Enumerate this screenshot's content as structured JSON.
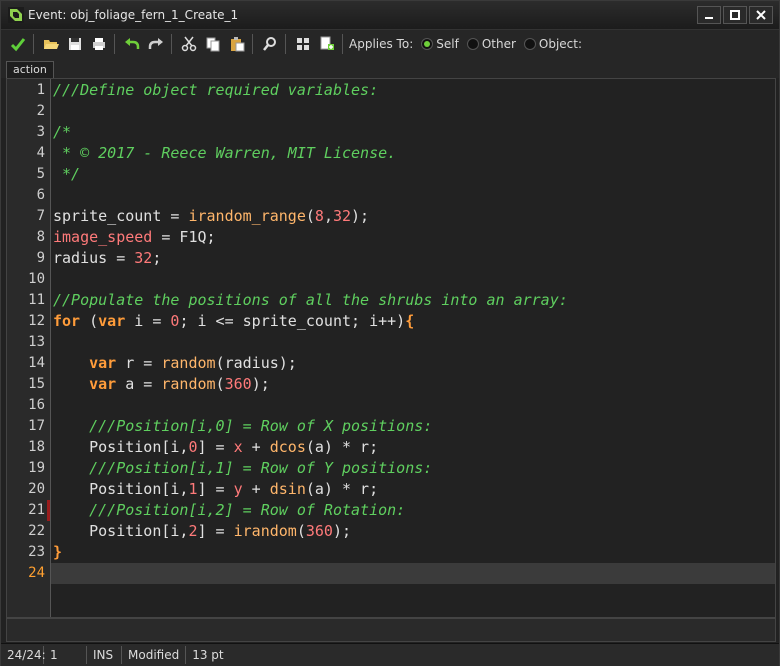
{
  "window": {
    "title": "Event: obj_foliage_fern_1_Create_1"
  },
  "toolbar": {
    "applies_to_label": "Applies To:",
    "options": [
      {
        "label": "Self",
        "selected": true
      },
      {
        "label": "Other",
        "selected": false
      },
      {
        "label": "Object:",
        "selected": false
      }
    ]
  },
  "tabs": [
    {
      "label": "action"
    }
  ],
  "editor": {
    "current_line": 24,
    "marked_line": 21,
    "lines": [
      [
        {
          "t": "com",
          "v": "///Define object required variables:"
        }
      ],
      [],
      [
        {
          "t": "com",
          "v": "/*"
        }
      ],
      [
        {
          "t": "com",
          "v": " * © 2017 - Reece Warren, MIT License."
        }
      ],
      [
        {
          "t": "com",
          "v": " */"
        }
      ],
      [],
      [
        {
          "t": "txt",
          "v": "sprite_count = "
        },
        {
          "t": "fn",
          "v": "irandom_range"
        },
        {
          "t": "txt",
          "v": "("
        },
        {
          "t": "num",
          "v": "8"
        },
        {
          "t": "txt",
          "v": ","
        },
        {
          "t": "num",
          "v": "32"
        },
        {
          "t": "txt",
          "v": ");"
        }
      ],
      [
        {
          "t": "bi",
          "v": "image_speed"
        },
        {
          "t": "txt",
          "v": " = F1Q;"
        }
      ],
      [
        {
          "t": "txt",
          "v": "radius = "
        },
        {
          "t": "num",
          "v": "32"
        },
        {
          "t": "txt",
          "v": ";"
        }
      ],
      [],
      [
        {
          "t": "com",
          "v": "//Populate the positions of all the shrubs into an array:"
        }
      ],
      [
        {
          "t": "kw",
          "v": "for"
        },
        {
          "t": "txt",
          "v": " ("
        },
        {
          "t": "kw",
          "v": "var"
        },
        {
          "t": "txt",
          "v": " i = "
        },
        {
          "t": "num",
          "v": "0"
        },
        {
          "t": "txt",
          "v": "; i <= sprite_count; i++)"
        },
        {
          "t": "kw",
          "v": "{"
        }
      ],
      [],
      [
        {
          "t": "txt",
          "v": "    "
        },
        {
          "t": "kw",
          "v": "var"
        },
        {
          "t": "txt",
          "v": " r = "
        },
        {
          "t": "fn",
          "v": "random"
        },
        {
          "t": "txt",
          "v": "(radius);"
        }
      ],
      [
        {
          "t": "txt",
          "v": "    "
        },
        {
          "t": "kw",
          "v": "var"
        },
        {
          "t": "txt",
          "v": " a = "
        },
        {
          "t": "fn",
          "v": "random"
        },
        {
          "t": "txt",
          "v": "("
        },
        {
          "t": "num",
          "v": "360"
        },
        {
          "t": "txt",
          "v": ");"
        }
      ],
      [],
      [
        {
          "t": "txt",
          "v": "    "
        },
        {
          "t": "com",
          "v": "///Position[i,0] = Row of X positions:"
        }
      ],
      [
        {
          "t": "txt",
          "v": "    Position[i,"
        },
        {
          "t": "num",
          "v": "0"
        },
        {
          "t": "txt",
          "v": "] = "
        },
        {
          "t": "bi",
          "v": "x"
        },
        {
          "t": "txt",
          "v": " + "
        },
        {
          "t": "fn",
          "v": "dcos"
        },
        {
          "t": "txt",
          "v": "(a) * r;"
        }
      ],
      [
        {
          "t": "txt",
          "v": "    "
        },
        {
          "t": "com",
          "v": "///Position[i,1] = Row of Y positions:"
        }
      ],
      [
        {
          "t": "txt",
          "v": "    Position[i,"
        },
        {
          "t": "num",
          "v": "1"
        },
        {
          "t": "txt",
          "v": "] = "
        },
        {
          "t": "bi",
          "v": "y"
        },
        {
          "t": "txt",
          "v": " + "
        },
        {
          "t": "fn",
          "v": "dsin"
        },
        {
          "t": "txt",
          "v": "(a) * r;"
        }
      ],
      [
        {
          "t": "txt",
          "v": "    "
        },
        {
          "t": "com",
          "v": "///Position[i,2] = Row of Rotation:"
        }
      ],
      [
        {
          "t": "txt",
          "v": "    Position[i,"
        },
        {
          "t": "num",
          "v": "2"
        },
        {
          "t": "txt",
          "v": "] = "
        },
        {
          "t": "fn",
          "v": "irandom"
        },
        {
          "t": "txt",
          "v": "("
        },
        {
          "t": "num",
          "v": "360"
        },
        {
          "t": "txt",
          "v": ");"
        }
      ],
      [
        {
          "t": "kw",
          "v": "}"
        }
      ],
      []
    ]
  },
  "status": {
    "position": "24/24:",
    "column": "1",
    "mode": "INS",
    "modified": "Modified",
    "font_size": "13 pt"
  },
  "colors": {
    "comment": "#5fcf5f",
    "keyword": "#ff9c3a",
    "function": "#ffb66b",
    "number": "#ff7a7a",
    "current_line_number": "#ffa030",
    "accent": "#6fcf3a"
  }
}
